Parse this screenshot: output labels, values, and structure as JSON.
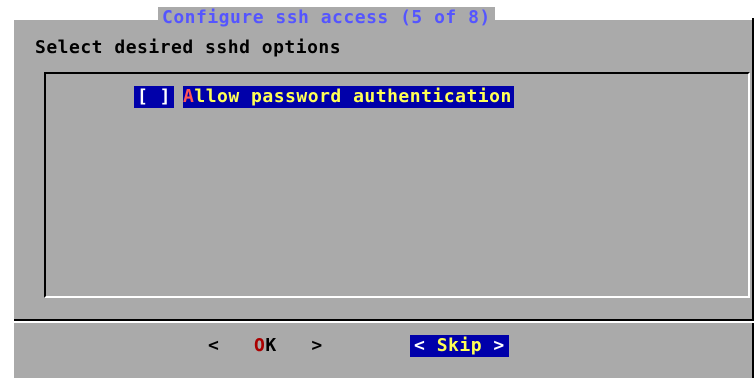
{
  "dialog": {
    "title": "Configure ssh access (5 of 8)",
    "prompt": "Select desired sshd options"
  },
  "options": [
    {
      "checkbox": "[ ]",
      "hotkey": "A",
      "label_rest": "llow password authentication",
      "checked": false
    }
  ],
  "buttons": {
    "ok": {
      "left": "<",
      "hotkey": "O",
      "rest": "K",
      "right": ">"
    },
    "skip": {
      "left": "<",
      "label": "Skip",
      "right": ">"
    }
  },
  "colors": {
    "dialog_bg": "#aaaaaa",
    "title": "#5555ff",
    "selection_bg": "#0000aa",
    "selection_text": "#ffff55",
    "hotkey": "#ff5555"
  }
}
